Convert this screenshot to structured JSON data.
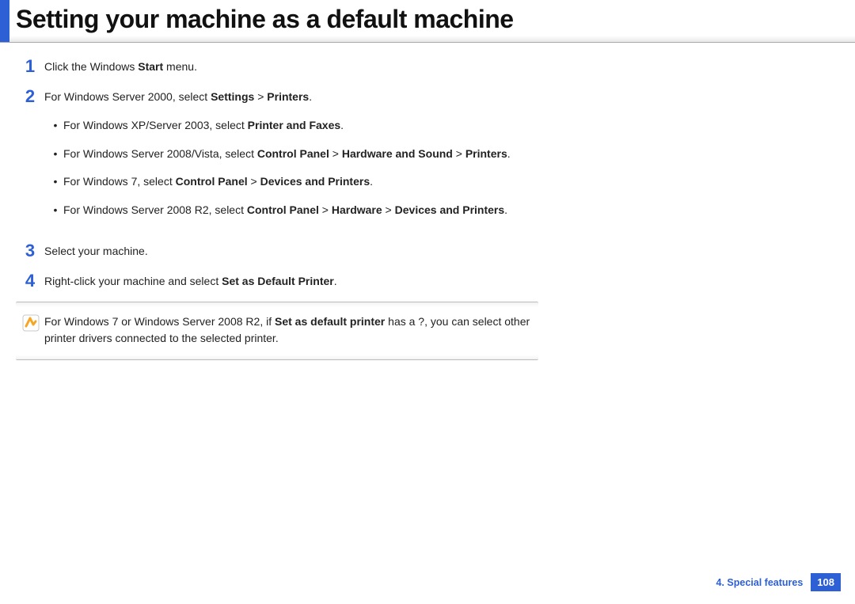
{
  "header": {
    "title": "Setting your machine as a default machine"
  },
  "steps": {
    "s1": {
      "num": "1",
      "prefix": "Click the Windows ",
      "bold": "Start",
      "suffix": " menu."
    },
    "s2": {
      "num": "2",
      "prefix": "For Windows Server 2000, select ",
      "b1": "Settings",
      "gt1": " > ",
      "b2": "Printers",
      "suffix": ".",
      "sub": {
        "a": {
          "prefix": "For Windows XP/Server 2003, select ",
          "b1": "Printer and Faxes",
          "suffix": "."
        },
        "b": {
          "prefix": "For Windows Server 2008/Vista, select ",
          "b1": "Control Panel",
          "gt1": " > ",
          "b2": "Hardware and Sound",
          "gt2": " > ",
          "b3": "Printers",
          "suffix": "."
        },
        "c": {
          "prefix": "For Windows 7, select ",
          "b1": "Control Panel",
          "gt1": " > ",
          "b2": "Devices and Printers",
          "suffix": "."
        },
        "d": {
          "prefix": "For Windows Server 2008 R2, select ",
          "b1": "Control Panel",
          "gt1": " > ",
          "b2": "Hardware",
          "gt2": " > ",
          "b3": "Devices and Printers",
          "suffix": "."
        }
      }
    },
    "s3": {
      "num": "3",
      "text": "Select your machine."
    },
    "s4": {
      "num": "4",
      "prefix": "Right-click your machine and select ",
      "b1": "Set as Default Printer",
      "suffix": "."
    }
  },
  "note": {
    "prefix": "For Windows 7 or Windows Server 2008 R2, if ",
    "b1": "Set as default printer",
    "suffix": " has a ?, you can select other printer drivers connected to the selected printer."
  },
  "footer": {
    "section": "4.  Special features",
    "page": "108"
  }
}
